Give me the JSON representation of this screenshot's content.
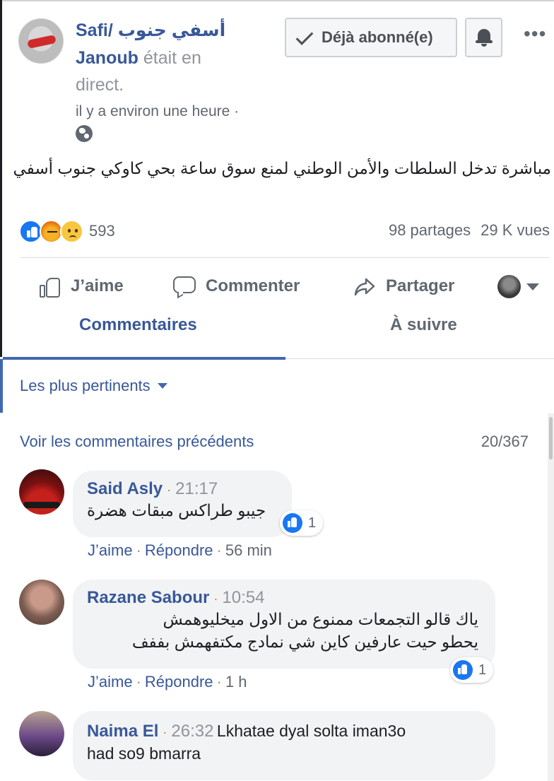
{
  "post": {
    "page_name_line1": "Safi/ أسفي جنوب",
    "page_name_line2": "Janoub",
    "status_line2": " était en",
    "status_line3": "direct.",
    "timestamp": "il y a environ une heure ·",
    "subscribe_label": "Déjà abonné(e)",
    "text": "مباشرة تدخل السلطات والأمن الوطني لمنع سوق ساعة بحي كاوكي جنوب أسفي"
  },
  "stats": {
    "reactions_count": "593",
    "shares": "98 partages",
    "views": "29 K vues"
  },
  "actions": {
    "like": "J’aime",
    "comment": "Commenter",
    "share": "Partager"
  },
  "tabs": {
    "comments": "Commentaires",
    "follow": "À suivre"
  },
  "comments_section": {
    "sort_label": "Les plus pertinents",
    "previous_link": "Voir les commentaires précédents",
    "count": "20/367",
    "items": [
      {
        "author": "Said Asly",
        "time": "21:17",
        "text": "جيبو طراكس مبقات هضرة",
        "likes": "1",
        "like_action": "J’aime",
        "reply_action": "Répondre",
        "age": "56 min"
      },
      {
        "author": "Razane Sabour",
        "time": "10:54",
        "text_line1": "ياك قالو التجمعات ممنوع من الاول ميخليوهمش",
        "text_line2": "يحطو حيت عارفين كاين شي نمادج مكتفهمش بففف",
        "likes": "1",
        "like_action": "J’aime",
        "reply_action": "Répondre",
        "age": "1 h"
      },
      {
        "author": "Naima El",
        "time": "26:32",
        "text_line1": "Lkhatae dyal solta iman3o",
        "text_line2": "had so9 bmarra"
      }
    ]
  },
  "colors": {
    "brand_blue": "#385898",
    "like_blue": "#1877f2",
    "muted": "#606770"
  }
}
